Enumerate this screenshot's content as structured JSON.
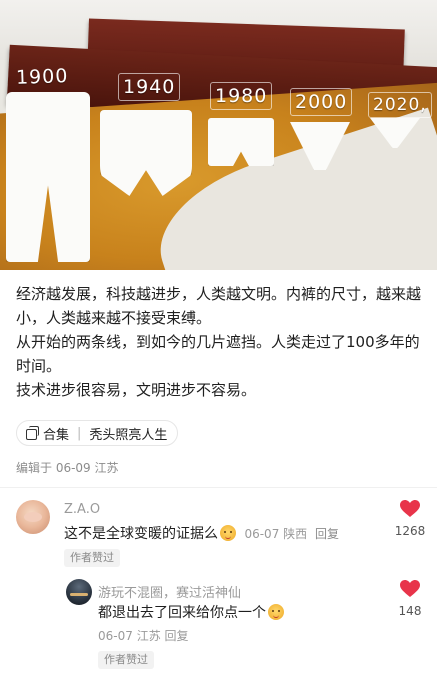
{
  "hero": {
    "years": [
      "1900",
      "1940",
      "1980",
      "2000",
      "2020,"
    ]
  },
  "post": {
    "paragraphs": [
      "经济越发展，科技越进步，人类越文明。内裤的尺寸，越来越小，人类越来越不接受束缚。",
      "从开始的两条线，到如今的几片遮挡。人类走过了100多年的时间。",
      "技术进步很容易，文明进步不容易。"
    ],
    "collection_label": "合集",
    "collection_name": "秃头照亮人生",
    "edit_meta": "编辑于 06-09 江苏"
  },
  "comments": [
    {
      "name": "Z.A.O",
      "text": "这不是全球变暖的证据么",
      "date": "06-07",
      "location": "陕西",
      "reply_label": "回复",
      "badge": "作者赞过",
      "likes": "1268",
      "like_color": "#e8344a"
    },
    {
      "name": "游玩不混圈，赛过活神仙",
      "text": "都退出去了回来给你点一个",
      "date": "06-07",
      "location": "江苏",
      "reply_label": "回复",
      "badge": "作者赞过",
      "likes": "148",
      "like_color": "#e8344a"
    }
  ]
}
